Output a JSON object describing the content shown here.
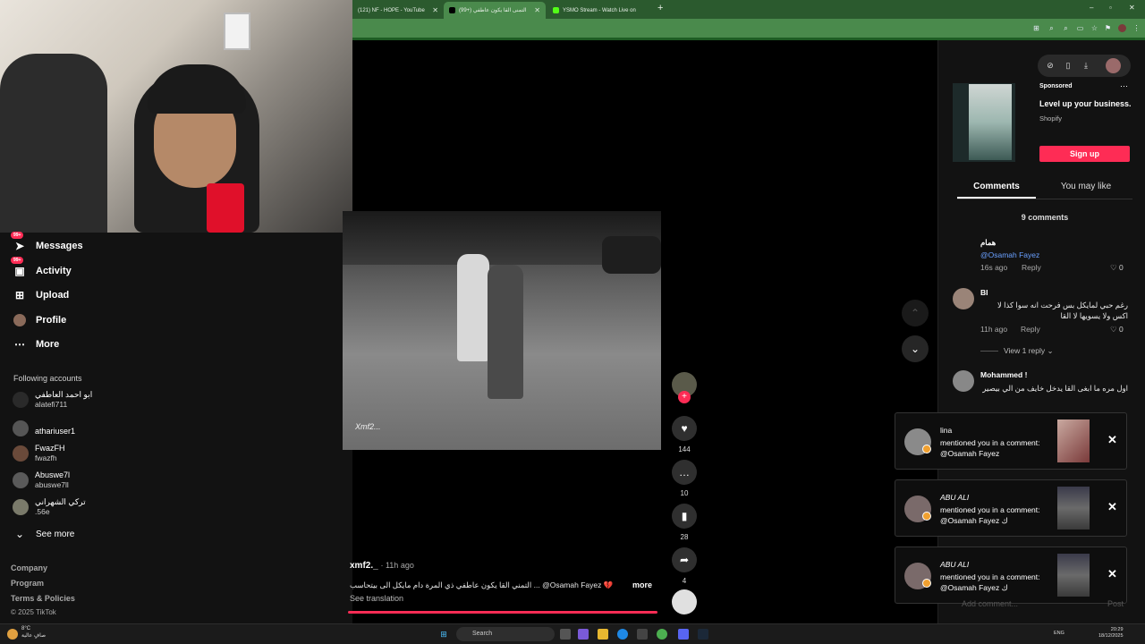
{
  "browser": {
    "tabs": [
      {
        "label": "(121) NF - HOPE - YouTube"
      },
      {
        "label": "(99+) التمنى القا يكون عاطفي"
      },
      {
        "label": "YSMO Stream - Watch Live on"
      }
    ],
    "new_tab": "+",
    "window_controls": [
      "–",
      "▫",
      "✕"
    ]
  },
  "sidebar": {
    "nav": [
      {
        "label": "Messages",
        "badge": "99+",
        "icon": "paper-plane-icon"
      },
      {
        "label": "Activity",
        "badge": "99+",
        "icon": "inbox-icon"
      },
      {
        "label": "Upload",
        "icon": "plus-square-icon"
      },
      {
        "label": "Profile",
        "icon": "avatar-icon"
      },
      {
        "label": "More",
        "icon": "dots-icon"
      }
    ],
    "following_title": "Following accounts",
    "accounts": [
      {
        "name": "ابو احمد العاطفي",
        "username": "alatefi711"
      },
      {
        "name": "athariuser1",
        "username": ""
      },
      {
        "name": "FwazFH",
        "username": "fwazfh"
      },
      {
        "name": "Abuswe7l",
        "username": "abuswe7ll"
      },
      {
        "name": "تركي الشهراني",
        "username": ".56e"
      }
    ],
    "see_more": "See more",
    "footer": [
      "Company",
      "Program",
      "Terms & Policies",
      "© 2025 TikTok"
    ]
  },
  "video": {
    "watermark": "Xmf2...",
    "actions": [
      {
        "name": "like",
        "count": "144"
      },
      {
        "name": "comment",
        "count": "10"
      },
      {
        "name": "save",
        "count": "28"
      },
      {
        "name": "share",
        "count": "4"
      }
    ],
    "author": "xmf2._",
    "posted": "· 11h ago",
    "caption": "التمني القا يكون عاطفي ذي المرة دام مايكل الى بيتحاسب ... @Osamah Fayez 💔",
    "more": "more",
    "see_translation": "See translation"
  },
  "ad": {
    "sponsored": "Sponsored",
    "title": "Level up your business.",
    "brand": "Shopify",
    "cta": "Sign up"
  },
  "panel": {
    "tab_comments": "Comments",
    "tab_like": "You may like",
    "count": "9 comments",
    "comments": [
      {
        "name": "همام",
        "text": "@Osamah Fayez",
        "time": "16s ago",
        "reply": "Reply",
        "likes": "0"
      },
      {
        "name": "BI",
        "text": "رغم حبي لمايكل بس فرحت انه سوا كذا لا اكس ولا يسويها لا القا",
        "time": "11h ago",
        "reply": "Reply",
        "likes": "0"
      },
      {
        "name": "Mohammed !",
        "text": "اول مره ما ابغى القا يدخل خايف من الي بيصير",
        "time": "11h ago",
        "reply": "Reply",
        "likes": "1"
      }
    ],
    "view_reply": "View 1 reply",
    "add_comment": "Add comment...",
    "post": "Post"
  },
  "notifications": [
    {
      "name": "lina",
      "message": "mentioned you in a comment: @Osamah Fayez"
    },
    {
      "name": "ABU ALI",
      "message": "mentioned you in a comment: @Osamah Fayez ك"
    },
    {
      "name": "ABU ALI",
      "message": "mentioned you in a comment: @Osamah Fayez ك"
    }
  ],
  "taskbar": {
    "weather_temp": "8°C",
    "weather_desc": "صافٍ عالية",
    "search": "Search",
    "lang": "ENG",
    "time": "20:29",
    "date": "18/12/2025"
  },
  "colors": {
    "accent": "#fe2c55",
    "chrome_green": "#4a8a4c",
    "bg": "#121212"
  }
}
